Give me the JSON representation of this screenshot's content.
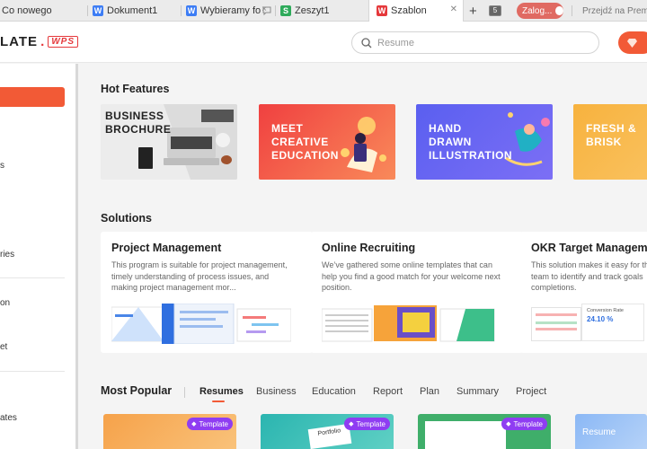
{
  "tabs": [
    {
      "label": "Co nowego",
      "icon": "wps-icon"
    },
    {
      "label": "Dokument1",
      "icon": "writer-icon"
    },
    {
      "label": "Wybieramy fo",
      "icon": "writer-icon"
    },
    {
      "label": "Zeszyt1",
      "icon": "spreadsheet-icon"
    },
    {
      "label": "Szablon",
      "icon": "template-icon"
    }
  ],
  "tab_count": "5",
  "login_label": "Zalog...",
  "premium_label": "Przejdź na Premi",
  "logo": {
    "text": "LATE",
    "brand": "WPS"
  },
  "search": {
    "placeholder": "Resume"
  },
  "sidebar": {
    "items": [
      "s",
      "ries",
      "on",
      "et",
      "ates"
    ]
  },
  "hot_features": {
    "title": "Hot Features",
    "items": [
      {
        "label": "BUSINESS\nBROCHURE"
      },
      {
        "label": "MEET\nCREATIVE\nEDUCATION"
      },
      {
        "label": "HAND\nDRAWN\nILLUSTRATION"
      },
      {
        "label": "FRESH &\nBRISK"
      }
    ]
  },
  "solutions": {
    "title": "Solutions",
    "items": [
      {
        "title": "Project Management",
        "desc": "This program is suitable for project management, timely understanding of process issues, and making project management mor..."
      },
      {
        "title": "Online Recruiting",
        "desc": "We’ve gathered some online templates that can help you find a good match for your welcome next position."
      },
      {
        "title": "OKR Target Manageme",
        "desc": "This solution makes it easy for th team to identify and track goals completions.",
        "thumb_text": "Conversion Rate",
        "thumb_value": "24.10 %"
      }
    ]
  },
  "most_popular": {
    "title": "Most Popular",
    "tabs": [
      "Resumes",
      "Business",
      "Education",
      "Report",
      "Plan",
      "Summary",
      "Project"
    ],
    "active_tab": "Resumes",
    "cards": [
      {
        "badge": "Template"
      },
      {
        "badge": "Template",
        "title": "Portfolio"
      },
      {
        "badge": "Template"
      },
      {
        "title": "Resume"
      }
    ]
  },
  "colors": {
    "accent": "#f25a36",
    "badge": "#8f3df2"
  }
}
